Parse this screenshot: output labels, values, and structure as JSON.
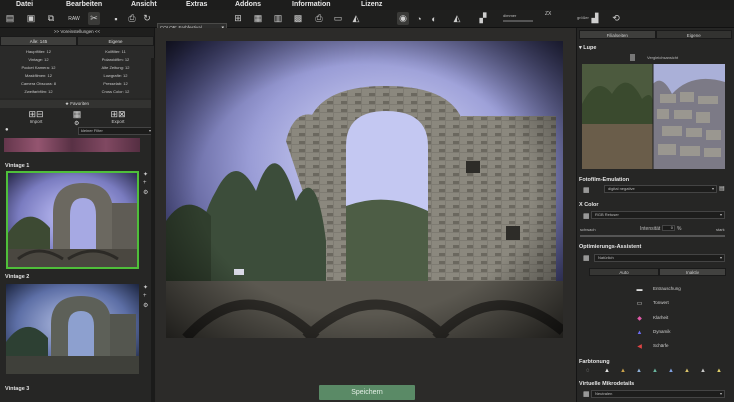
{
  "menu": [
    "Datei",
    "Bearbeiten",
    "Ansicht",
    "Extras",
    "Addons",
    "Information",
    "Lizenz"
  ],
  "toolbar": {
    "preset": "COLOR: Farbfestival",
    "slider_label": "dimmer",
    "zoom_value": "ZX",
    "zoom_suffix": "größer"
  },
  "left": {
    "header": ">> Voreinstellungen <<",
    "tabs": [
      "Alle: 145",
      "Eigene"
    ],
    "categories": [
      "Hauptfilter: 12",
      "Kollfilter: 11",
      "Vintage: 12",
      "Polaroidfilm: 12",
      "Pocket Kamera: 12",
      "Alte Zeitung: 12",
      "Maskfilmen: 12",
      "Lowgrafie: 12",
      "Camera Obscura: 8",
      "Presselab: 12",
      "Zweifarbfilm: 12",
      "Cross Color: 12"
    ],
    "favorites": "Favoriten",
    "import": "Import",
    "export": "Export",
    "filter_select": "kleiner Filter",
    "presets": [
      {
        "label": "Vintage 1"
      },
      {
        "label": "Vintage 2"
      },
      {
        "label": "Vintage 3"
      }
    ]
  },
  "center": {
    "save_button": "Speichern"
  },
  "right": {
    "tabs": [
      "Filialseiten",
      "Eigene"
    ],
    "lupe": "Lupe",
    "compare": "Vergleichsansicht",
    "fotofilm": {
      "title": "Fotofilm-Emulation",
      "value": "digital negative"
    },
    "xcolor": {
      "title": "X Color",
      "value": "RGB Retuser",
      "weak": "schwach",
      "strong": "stark",
      "intensity_label": "Intensität",
      "intensity_value": "0",
      "unit": "%"
    },
    "optim": {
      "title": "Optimierungs-Assistent",
      "value": "Natürlich",
      "buttons": [
        "Auto",
        "Inaktiv"
      ],
      "items": [
        "Entrauschung",
        "Tonwert",
        "Klarheit",
        "Dynamik",
        "Schärfe"
      ]
    },
    "farbtonung": "Farbtonung",
    "mikro": {
      "title": "Virtuelle Mikrodetails",
      "value": "Neutralen"
    }
  },
  "colors": {
    "accent_green": "#4fbf3a",
    "save_button": "#5a8a66"
  }
}
